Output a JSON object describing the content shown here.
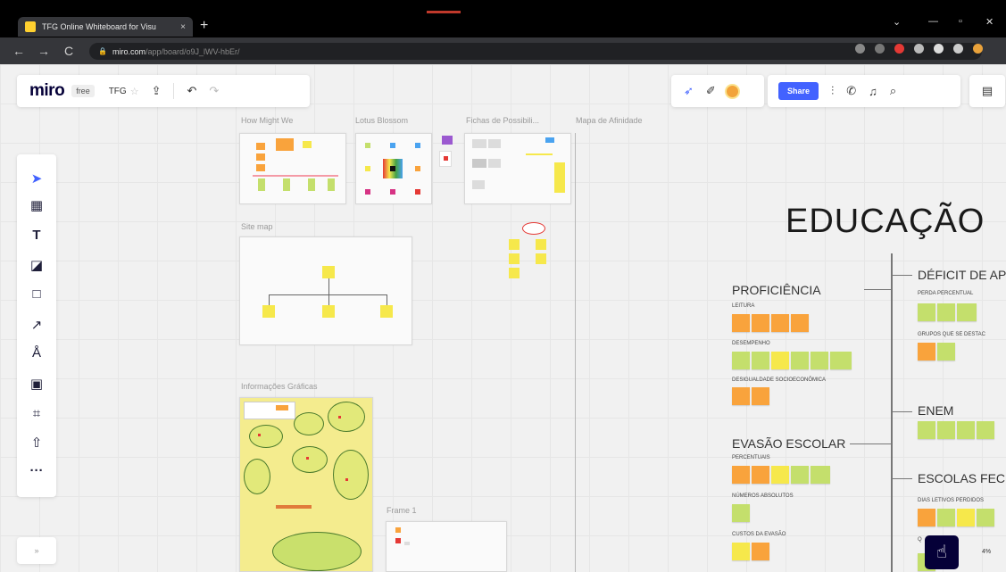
{
  "browser": {
    "tab_title": "TFG Online Whiteboard for Visu",
    "tab_close": "×",
    "new_tab": "+",
    "url_host": "miro.com",
    "url_path": "/app/board/o9J_lWV-hbEr/",
    "nav": {
      "back": "←",
      "forward": "→",
      "reload": "C"
    },
    "window": {
      "minimize": "—",
      "maximize": "▫",
      "close": "✕",
      "chevron": "⌄"
    }
  },
  "miro": {
    "logo": "miro",
    "plan": "free",
    "board_name": "TFG",
    "share_label": "Share",
    "zoom_level": "4%"
  },
  "frames": {
    "how_might_we": "How Might We",
    "lotus": "Lotus Blossom",
    "fichas": "Fichas de Possibili...",
    "mapa": "Mapa de Afinidade",
    "site_map": "Site map",
    "info": "Informações Gráficas",
    "frame1": "Frame 1"
  },
  "education": {
    "title": "EDUCAÇÃO",
    "proficiencia": "PROFICIÊNCIA",
    "leitura": "LEITURA",
    "desempenho": "DESEMPENHO",
    "desigualdade": "DESIGUALDADE SOCIOECONÔMICA",
    "evasao": "EVASÃO ESCOLAR",
    "percentuais": "PERCENTUAIS",
    "numeros": "NÚMEROS ABSOLUTOS",
    "custos": "CUSTOS DA EVASÃO",
    "deficit": "DÉFICIT DE AP",
    "perda": "PERDA PERCENTUAL",
    "grupos": "GRUPOS QUE SE DESTAC",
    "enem": "ENEM",
    "escolas": "ESCOLAS FECH",
    "dias": "DIAS LETIVOS PERDIDOS",
    "q": "Q"
  },
  "colors": {
    "accent": "#4262ff",
    "note_orange": "#f9a33c",
    "note_yellow": "#f6e84b",
    "note_green": "#c4df6c"
  }
}
